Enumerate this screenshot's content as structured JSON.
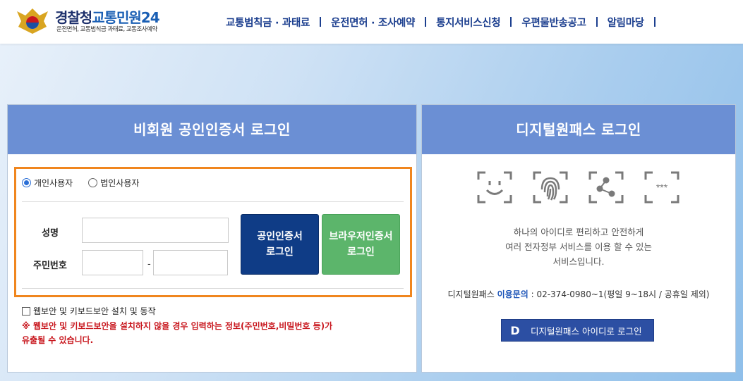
{
  "header": {
    "logo_title_main": "경찰청",
    "logo_title_accent": "교통민원24",
    "logo_subtitle": "운전면허, 교통범칙금 과태료, 교통조사예약",
    "nav": [
      {
        "label": "교통범칙금 · 과태료"
      },
      {
        "label": "운전면허 · 조사예약"
      },
      {
        "label": "통지서비스신청"
      },
      {
        "label": "우편물반송공고"
      },
      {
        "label": "알림마당"
      }
    ]
  },
  "left_panel": {
    "title": "비회원 공인인증서 로그인",
    "user_types": [
      {
        "label": "개인사용자",
        "selected": true
      },
      {
        "label": "법인사용자",
        "selected": false
      }
    ],
    "name_label": "성명",
    "name_value": "",
    "rrn_label": "주민번호",
    "rrn_front_value": "",
    "rrn_back_value": "",
    "rrn_separator": "-",
    "cert_button_line1": "공인인증서",
    "cert_button_line2": "로그인",
    "browser_button_line1": "브라우저인증서",
    "browser_button_line2": "로그인",
    "security_checkbox_label": "웹보안 및 키보드보안 설치 및 동작",
    "security_checked": false,
    "warning_line1": "※ 웹보안 및 키보드보안을 설치하지 않을 경우 입력하는 정보(주민번호,비밀번호 등)가",
    "warning_line2": "유출될 수 있습니다."
  },
  "right_panel": {
    "title": "디지털원패스 로그인",
    "icons": [
      "face-recognition-icon",
      "fingerprint-icon",
      "pattern-icon",
      "pin-icon"
    ],
    "desc_line1": "하나의 아이디로 편리하고 안전하게",
    "desc_line2": "여러 전자정부 서비스를 이용 할 수 있는",
    "desc_line3": "서비스입니다.",
    "contact_prefix": "디지털원패스",
    "contact_highlight": "이용문의",
    "contact_rest": ": 02-374-0980~1(평일 9~18시 / 공휴일 제외)",
    "login_button_mark": "D",
    "login_button_label": "디지털원패스 아이디로 로그인"
  },
  "colors": {
    "panel_header": "#6b8fd4",
    "login_box_border": "#f0861e",
    "cert_button": "#0f3c86",
    "browser_button": "#5cb56b",
    "warning_text": "#c8161d",
    "nav_text": "#1c3f8f"
  }
}
